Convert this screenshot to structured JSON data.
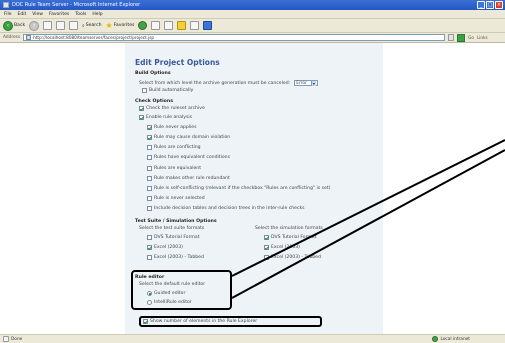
{
  "window": {
    "title": "DOC Rule Team Server - Microsoft Internet Explorer",
    "buttons": [
      "_",
      "□",
      "×"
    ]
  },
  "menu": [
    "File",
    "Edit",
    "View",
    "Favorites",
    "Tools",
    "Help"
  ],
  "toolbar": {
    "back_label": "Back",
    "search_label": "Search",
    "favorites_label": "Favorites"
  },
  "address": {
    "label": "Address",
    "url": "http://localhost:8080/teamserver/faces/project/project.jsp",
    "go_label": "Go",
    "links_label": "Links"
  },
  "page": {
    "title": "Edit Project Options",
    "build_options": {
      "heading": "Build Options",
      "level_text": "Select from which level the archive generation must be canceled:",
      "level_value": "Error",
      "auto_label": "Build automatically"
    },
    "check_options": {
      "heading": "Check Options",
      "items": [
        {
          "label": "Check the ruleset archive",
          "checked": true
        },
        {
          "label": "Enable rule analysis",
          "checked": true
        }
      ],
      "sub_items": [
        {
          "label": "Rule never applies",
          "checked": true
        },
        {
          "label": "Rule may cause domain violation",
          "checked": true
        },
        {
          "label": "Rules are conflicting",
          "checked": false
        },
        {
          "label": "Rules have equivalent conditions",
          "checked": false
        },
        {
          "label": "Rules are equivalent",
          "checked": false
        },
        {
          "label": "Rule makes other rule redundant",
          "checked": false
        },
        {
          "label": "Rule is self-conflicting (relevant if the checkbox \"Rules are conflicting\" is set)",
          "checked": false
        },
        {
          "label": "Rule is never selected",
          "checked": false
        },
        {
          "label": "Include decision tables and decision trees in the inter-rule checks",
          "checked": false
        }
      ]
    },
    "test_suite": {
      "heading": "Test Suite / Simulation Options",
      "test_caption": "Select the test suite formats",
      "sim_caption": "Select the simulation formats",
      "test_formats": [
        {
          "label": "DVS Tutorial Format",
          "checked": false
        },
        {
          "label": "Excel (2003)",
          "checked": true
        },
        {
          "label": "Excel (2003) - Tabbed",
          "checked": false
        }
      ],
      "sim_formats": [
        {
          "label": "DVS Tutorial Format",
          "checked": true
        },
        {
          "label": "Excel (2003)",
          "checked": true
        },
        {
          "label": "Excel (2003) - Tabbed",
          "checked": false
        }
      ]
    },
    "rule_editor": {
      "heading": "Rule editor",
      "caption": "Select the default rule editor",
      "options": [
        {
          "label": "Guided editor",
          "selected": true
        },
        {
          "label": "IntelliRule editor",
          "selected": false
        }
      ]
    },
    "explorer_option": {
      "label": "Show number of elements in the Rule Explorer",
      "checked": true
    }
  },
  "status": {
    "left": "Done",
    "zone": "Local intranet"
  },
  "colors": {
    "title_blue": "#3a5a9b",
    "panel_bg": "#eef3f8",
    "xp_chrome": "#ece9d8"
  }
}
